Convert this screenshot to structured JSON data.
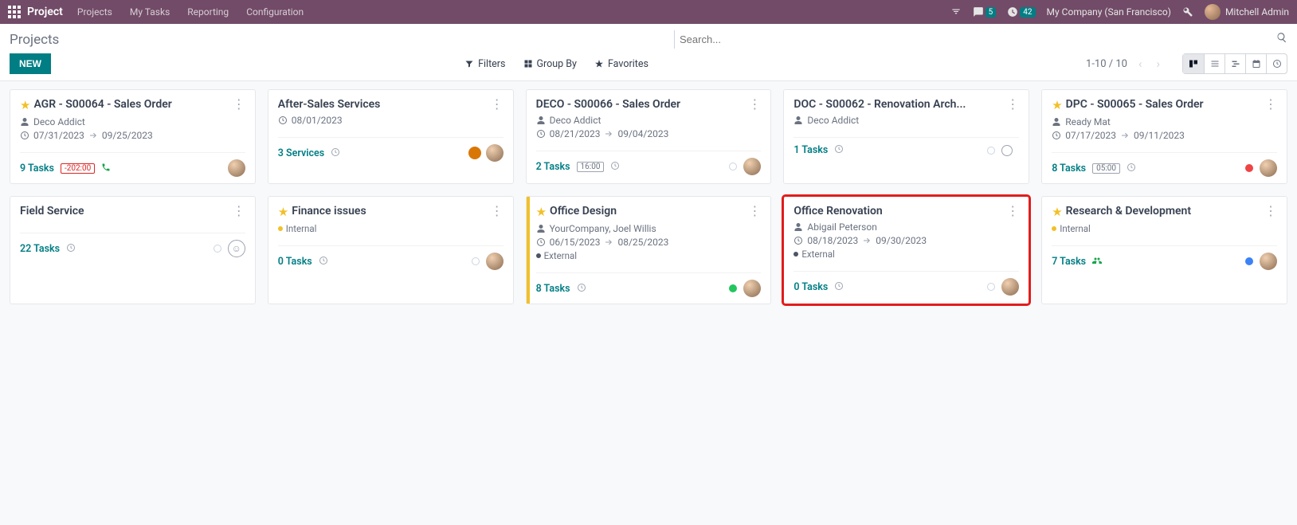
{
  "topbar": {
    "brand": "Project",
    "nav": [
      "Projects",
      "My Tasks",
      "Reporting",
      "Configuration"
    ],
    "messages_badge": "5",
    "activities_badge": "42",
    "company": "My Company (San Francisco)",
    "user": "Mitchell Admin"
  },
  "header": {
    "title": "Projects",
    "new_btn": "NEW",
    "search_placeholder": "Search...",
    "filters": "Filters",
    "groupby": "Group By",
    "favorites": "Favorites",
    "pager": "1-10 / 10"
  },
  "cards": [
    {
      "star": true,
      "title": "AGR - S00064 - Sales Order",
      "subtitle": "Deco Addict",
      "date_from": "07/31/2023",
      "date_to": "09/25/2023",
      "tasks": "9 Tasks",
      "pill": "-202:00",
      "pill_red": true,
      "phone": true,
      "avatar": true
    },
    {
      "star": false,
      "title": "After-Sales Services",
      "date_from": "08/01/2023",
      "tasks": "3 Services",
      "clock_foot": true,
      "medal": true,
      "avatar": true
    },
    {
      "star": false,
      "title": "DECO - S00066 - Sales Order",
      "subtitle": "Deco Addict",
      "date_from": "08/21/2023",
      "date_to": "09/04/2023",
      "tasks": "2 Tasks",
      "pill": "16:00",
      "pill_red": false,
      "clock_foot": true,
      "avatar": true,
      "empty_dot": true
    },
    {
      "star": false,
      "title": "DOC - S00062 - Renovation Arch...",
      "subtitle": "Deco Addict",
      "tasks": "1 Tasks",
      "clock_foot": true,
      "ring": true,
      "empty_dot": true
    },
    {
      "star": true,
      "title": "DPC - S00065 - Sales Order",
      "subtitle": "Ready Mat",
      "date_from": "07/17/2023",
      "date_to": "09/11/2023",
      "tasks": "8 Tasks",
      "pill": "05:00",
      "pill_red": false,
      "clock_foot": true,
      "dot": "red",
      "avatar": true
    },
    {
      "star": false,
      "title": "Field Service",
      "tasks": "22 Tasks",
      "clock_foot": true,
      "smiley": true,
      "empty_dot": true
    },
    {
      "star": true,
      "title": "Finance issues",
      "tag": "Internal",
      "tag_cls": "internal",
      "tasks": "0 Tasks",
      "clock_foot": true,
      "avatar": true,
      "empty_dot": true
    },
    {
      "star": true,
      "yellowbar": true,
      "title": "Office Design",
      "subtitle": "YourCompany, Joel Willis",
      "date_from": "06/15/2023",
      "date_to": "08/25/2023",
      "tag": "External",
      "tag_cls": "external",
      "tasks": "8 Tasks",
      "clock_foot": true,
      "dot": "green",
      "avatar": true
    },
    {
      "star": false,
      "highlight": true,
      "title": "Office Renovation",
      "subtitle": "Abigail Peterson",
      "date_from": "08/18/2023",
      "date_to": "09/30/2023",
      "tag": "External",
      "tag_cls": "external",
      "tasks": "0 Tasks",
      "clock_foot": true,
      "avatar": true,
      "empty_dot": true
    },
    {
      "star": true,
      "title": "Research & Development",
      "tag": "Internal",
      "tag_cls": "internal",
      "tasks": "7 Tasks",
      "group": true,
      "dot": "blue",
      "avatar": true
    }
  ]
}
